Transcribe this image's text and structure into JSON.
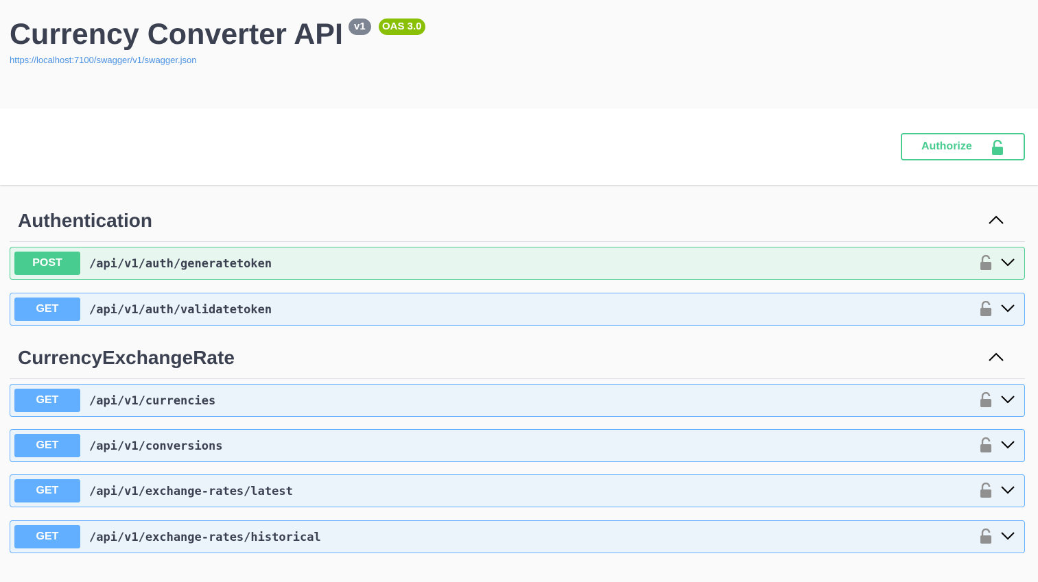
{
  "info": {
    "title": "Currency Converter API",
    "version_badge": "v1",
    "oas_badge": "OAS 3.0",
    "spec_url": "https://localhost:7100/swagger/v1/swagger.json"
  },
  "authorize": {
    "label": "Authorize",
    "icon": "unlocked-lock-icon",
    "color": "#49cc90"
  },
  "tags": [
    {
      "name": "Authentication",
      "operations": [
        {
          "method": "POST",
          "path": "/api/v1/auth/generatetoken"
        },
        {
          "method": "GET",
          "path": "/api/v1/auth/validatetoken"
        }
      ]
    },
    {
      "name": "CurrencyExchangeRate",
      "operations": [
        {
          "method": "GET",
          "path": "/api/v1/currencies"
        },
        {
          "method": "GET",
          "path": "/api/v1/conversions"
        },
        {
          "method": "GET",
          "path": "/api/v1/exchange-rates/latest"
        },
        {
          "method": "GET",
          "path": "/api/v1/exchange-rates/historical"
        }
      ]
    }
  ],
  "colors": {
    "post": "#49cc90",
    "get": "#61affe",
    "version_badge": "#7d8492",
    "oas_badge": "#89bf04",
    "link": "#4990e2"
  }
}
